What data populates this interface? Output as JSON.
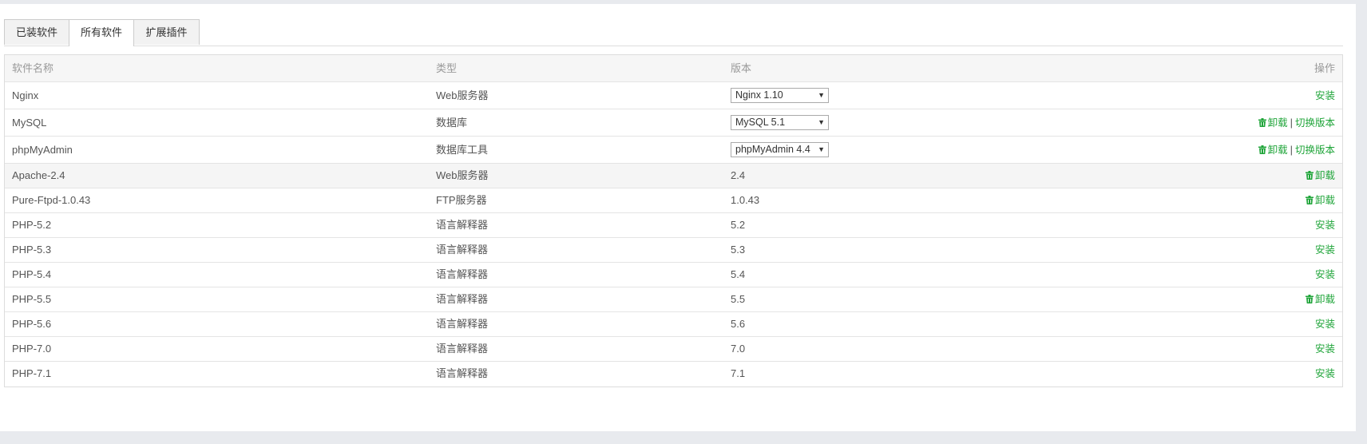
{
  "tabs": [
    "已装软件",
    "所有软件",
    "扩展插件"
  ],
  "columns": [
    "软件名称",
    "类型",
    "版本",
    "操作"
  ],
  "rows": [
    {
      "name": "Nginx",
      "type": "Web服务器",
      "version": "Nginx 1.10",
      "select": true,
      "actions": [
        "安装"
      ]
    },
    {
      "name": "MySQL",
      "type": "数据库",
      "version": "MySQL 5.1",
      "select": true,
      "actions": [
        "卸载",
        "切换版本"
      ]
    },
    {
      "name": "phpMyAdmin",
      "type": "数据库工具",
      "version": "phpMyAdmin 4.4",
      "select": true,
      "actions": [
        "卸载",
        "切换版本"
      ]
    },
    {
      "name": "Apache-2.4",
      "type": "Web服务器",
      "version": "2.4",
      "select": false,
      "actions": [
        "卸载"
      ]
    },
    {
      "name": "Pure-Ftpd-1.0.43",
      "type": "FTP服务器",
      "version": "1.0.43",
      "select": false,
      "actions": [
        "卸载"
      ]
    },
    {
      "name": "PHP-5.2",
      "type": "语言解释器",
      "version": "5.2",
      "select": false,
      "actions": [
        "安装"
      ]
    },
    {
      "name": "PHP-5.3",
      "type": "语言解释器",
      "version": "5.3",
      "select": false,
      "actions": [
        "安装"
      ]
    },
    {
      "name": "PHP-5.4",
      "type": "语言解释器",
      "version": "5.4",
      "select": false,
      "actions": [
        "安装"
      ]
    },
    {
      "name": "PHP-5.5",
      "type": "语言解释器",
      "version": "5.5",
      "select": false,
      "actions": [
        "卸载"
      ]
    },
    {
      "name": "PHP-5.6",
      "type": "语言解释器",
      "version": "5.6",
      "select": false,
      "actions": [
        "安装"
      ]
    },
    {
      "name": "PHP-7.0",
      "type": "语言解释器",
      "version": "7.0",
      "select": false,
      "actions": [
        "安装"
      ]
    },
    {
      "name": "PHP-7.1",
      "type": "语言解释器",
      "version": "7.1",
      "select": false,
      "actions": [
        "安装"
      ]
    }
  ],
  "colors": {
    "accent": "#20a53a",
    "highlight_row": "#f5f5f5"
  }
}
